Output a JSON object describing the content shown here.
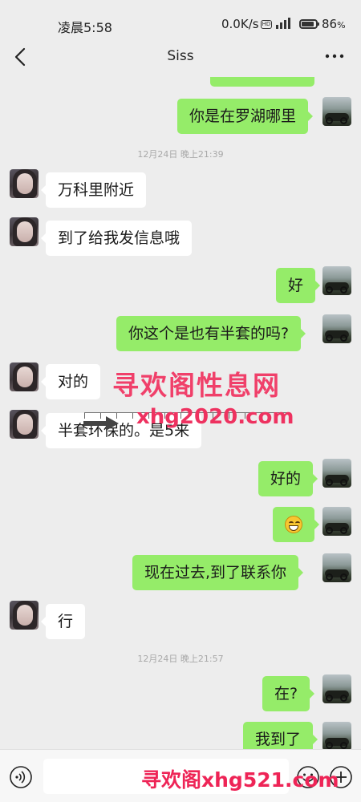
{
  "status": {
    "time": "凌晨5:58",
    "network_speed": "0.0K/s",
    "hd_label": "HD",
    "battery_text": "86",
    "battery_level": 0.86
  },
  "header": {
    "title": "Siss"
  },
  "messages": [
    {
      "text": "你是在罗湖哪里"
    },
    {
      "text": "12月24日 晚上21:39"
    },
    {
      "text": "万科里附近"
    },
    {
      "text": "到了给我发信息哦"
    },
    {
      "text": "好"
    },
    {
      "text": "你这个是也有半套的吗?"
    },
    {
      "text": "对的"
    },
    {
      "text": "半套环保的。是5来"
    },
    {
      "text": "好的"
    },
    {
      "text": "emoji-grin"
    },
    {
      "text": "现在过去,到了联系你"
    },
    {
      "text": "行"
    },
    {
      "text": "12月24日 晚上21:57"
    },
    {
      "text": "在?"
    },
    {
      "text": "我到了"
    }
  ],
  "watermarks": {
    "line1": "寻欢阁性息网",
    "line2": "xhg2020.com",
    "line3": "寻欢阁xhg521.com"
  },
  "input": {
    "placeholder": ""
  },
  "colors": {
    "outgoing_bubble": "#95ec69",
    "incoming_bubble": "#ffffff",
    "background": "#ededed",
    "watermark": "#ee3260"
  }
}
